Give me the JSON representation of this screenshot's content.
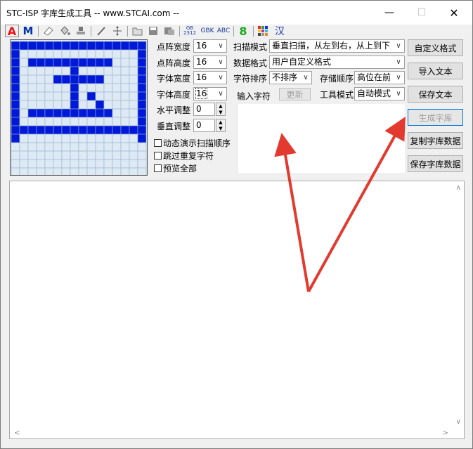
{
  "window": {
    "title": "STC-ISP 字库生成工具 -- www.STCAI.com --"
  },
  "titlebar_buttons": {
    "minimize": "—",
    "maximize": "☐",
    "close": "✕"
  },
  "toolbar": {
    "a_label": "A",
    "m_label": "M",
    "gb2312_label": "GB 2312",
    "gbk_label": "GBK",
    "abc_label": "ABC",
    "digit_label": "8",
    "han_label": "汉"
  },
  "colors": {
    "grid_on": "#0018d8",
    "grid_off": "#dde9f5",
    "grid_line": "#9bb2c9",
    "arrow": "#e23a2f"
  },
  "glyph_rows": [
    "################",
    "#..............#",
    "#.##########...#",
    "#......#.......#",
    "#....######....#",
    "#......#.......#",
    "#......#.#.....#",
    "#......#..#....#",
    "#.##########...#",
    "#..............#",
    "################",
    "#..............#"
  ],
  "settings": {
    "matrix_width": {
      "label": "点阵宽度",
      "value": "16"
    },
    "matrix_height": {
      "label": "点阵高度",
      "value": "16"
    },
    "font_width": {
      "label": "字体宽度",
      "value": "16"
    },
    "font_height": {
      "label": "字体高度",
      "value": "16"
    },
    "h_adjust": {
      "label": "水平调整",
      "value": "0"
    },
    "v_adjust": {
      "label": "垂直调整",
      "value": "0"
    },
    "scan_mode": {
      "label": "扫描模式",
      "value": "垂直扫描，从左到右，从上到下"
    },
    "data_format": {
      "label": "数据格式",
      "value": "用户自定义格式"
    },
    "char_sort": {
      "label": "字符排序",
      "value": "不排序"
    },
    "store_order": {
      "label": "存储顺序",
      "value": "高位在前"
    },
    "tool_mode": {
      "label": "工具模式",
      "value": "自动模式"
    },
    "input_label": "输入字符",
    "update_button": "更新"
  },
  "checkboxes": {
    "dynamic_demo": "动态演示扫描顺序",
    "skip_repeat": "跳过重复字符",
    "preview_all": "预览全部"
  },
  "buttons": {
    "custom_format": "自定义格式",
    "import_text": "导入文本",
    "save_text": "保存文本",
    "generate": "生成字库",
    "copy_data": "复制字库数据",
    "save_data": "保存字库数据"
  }
}
